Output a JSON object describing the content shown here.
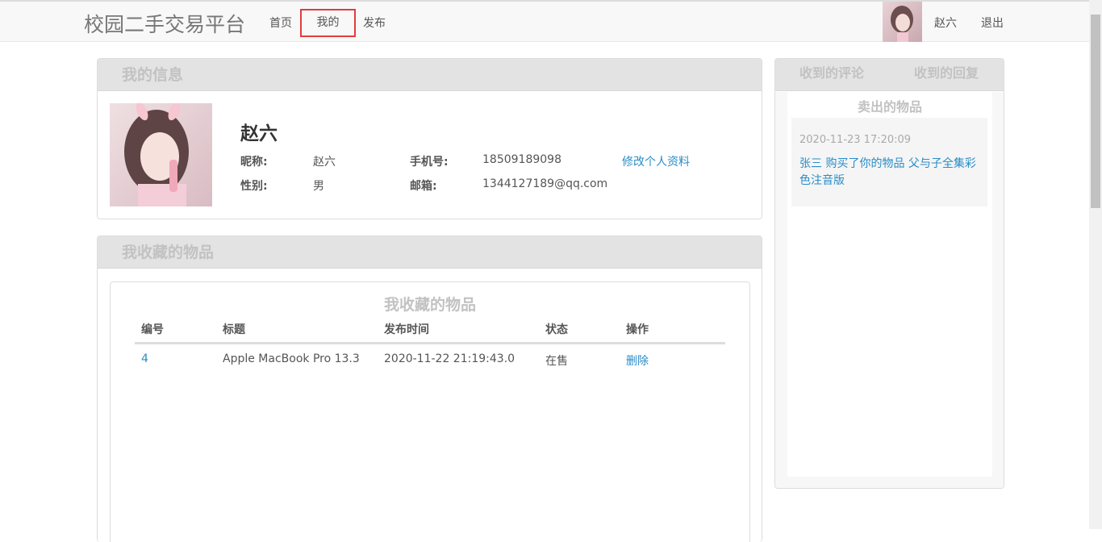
{
  "nav": {
    "brand": "校园二手交易平台",
    "home": "首页",
    "mine": "我的",
    "post": "发布",
    "username": "赵六",
    "logout": "退出"
  },
  "info": {
    "header": "我的信息",
    "name": "赵六",
    "nickname_label": "昵称:",
    "nickname": "赵六",
    "phone_label": "手机号:",
    "phone": "18509189098",
    "edit_link": "修改个人资料",
    "gender_label": "性别:",
    "gender": "男",
    "email_label": "邮箱:",
    "email": "1344127189@qq.com"
  },
  "favorites": {
    "header": "我收藏的物品",
    "title": "我收藏的物品",
    "columns": [
      "编号",
      "标题",
      "发布时间",
      "状态",
      "操作"
    ],
    "rows": [
      {
        "id": "4",
        "title": "Apple MacBook Pro 13.3",
        "time": "2020-11-22 21:19:43.0",
        "status": "在售",
        "action": "删除"
      }
    ]
  },
  "side": {
    "tab_comments": "收到的评论",
    "tab_replies": "收到的回复",
    "sub_title": "卖出的物品",
    "messages": [
      {
        "time": "2020-11-23 17:20:09",
        "text": "张三 购买了你的物品 父与子全集彩色注音版"
      }
    ]
  },
  "colors": {
    "accent_link": "#2a8cc7",
    "highlight_border": "#e33c3c",
    "panel_header_bg": "#e3e3e3"
  }
}
